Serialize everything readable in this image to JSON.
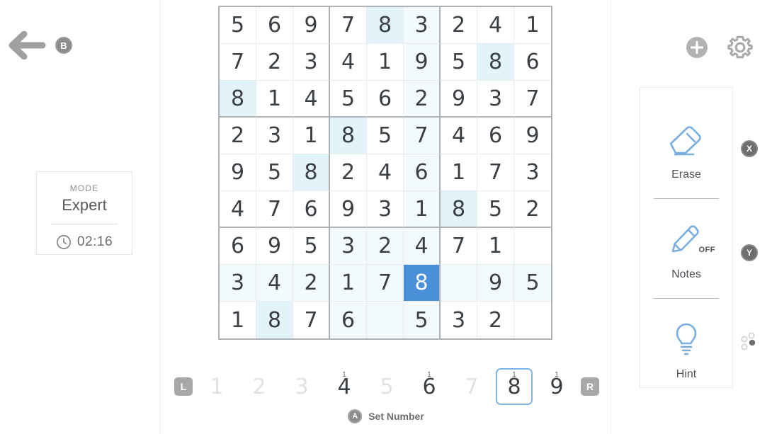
{
  "header": {
    "back_icon": "arrow-left-icon",
    "back_button_badge": "B",
    "add_icon": "plus-circle-icon",
    "settings_icon": "gear-icon"
  },
  "mode_card": {
    "label": "MODE",
    "value": "Expert",
    "clock_icon": "clock-icon",
    "time": "02:16"
  },
  "board": {
    "selected": {
      "row": 8,
      "col": 6,
      "value": "8"
    },
    "highlight_color": "#f2fafd",
    "same_number_color": "#e3f3fa",
    "selected_color": "#4a90d9",
    "grid_line_color": "#aeb2b5",
    "rows": [
      [
        "5",
        "6",
        "9",
        "7",
        "8",
        "3",
        "2",
        "4",
        "1"
      ],
      [
        "7",
        "2",
        "3",
        "4",
        "1",
        "9",
        "5",
        "8",
        "6"
      ],
      [
        "8",
        "1",
        "4",
        "5",
        "6",
        "2",
        "9",
        "3",
        "7"
      ],
      [
        "2",
        "3",
        "1",
        "8",
        "5",
        "7",
        "4",
        "6",
        "9"
      ],
      [
        "9",
        "5",
        "8",
        "2",
        "4",
        "6",
        "1",
        "7",
        "3"
      ],
      [
        "4",
        "7",
        "6",
        "9",
        "3",
        "1",
        "8",
        "5",
        "2"
      ],
      [
        "6",
        "9",
        "5",
        "3",
        "2",
        "4",
        "7",
        "1",
        ""
      ],
      [
        "3",
        "4",
        "2",
        "1",
        "7",
        "8",
        "",
        "9",
        "5"
      ],
      [
        "1",
        "8",
        "7",
        "6",
        "",
        "5",
        "3",
        "2",
        ""
      ]
    ]
  },
  "numpad": {
    "left_shoulder": "L",
    "right_shoulder": "R",
    "selected_digit": "8",
    "keys": [
      {
        "digit": "1",
        "count": "",
        "remaining": false
      },
      {
        "digit": "2",
        "count": "",
        "remaining": false
      },
      {
        "digit": "3",
        "count": "",
        "remaining": false
      },
      {
        "digit": "4",
        "count": "1",
        "remaining": true
      },
      {
        "digit": "5",
        "count": "",
        "remaining": false
      },
      {
        "digit": "6",
        "count": "1",
        "remaining": true
      },
      {
        "digit": "7",
        "count": "",
        "remaining": false
      },
      {
        "digit": "8",
        "count": "1",
        "remaining": true
      },
      {
        "digit": "9",
        "count": "1",
        "remaining": true
      }
    ]
  },
  "footer": {
    "action_badge": "A",
    "action_label": "Set Number"
  },
  "tools": [
    {
      "id": "erase",
      "label": "Erase",
      "icon": "eraser-icon",
      "state": "",
      "button": "X"
    },
    {
      "id": "notes",
      "label": "Notes",
      "icon": "pencil-icon",
      "state": "OFF",
      "button": "Y"
    },
    {
      "id": "hint",
      "label": "Hint",
      "icon": "lightbulb-icon",
      "state": "",
      "button": "dpad-icon"
    }
  ],
  "hardware_buttons": {
    "x": "X",
    "y": "Y",
    "dpad_icon": "dpad-cluster-icon"
  }
}
